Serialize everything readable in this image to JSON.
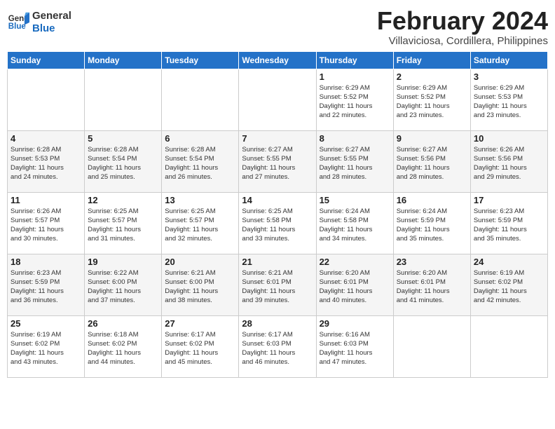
{
  "logo": {
    "line1": "General",
    "line2": "Blue"
  },
  "title": "February 2024",
  "location": "Villaviciosa, Cordillera, Philippines",
  "days_of_week": [
    "Sunday",
    "Monday",
    "Tuesday",
    "Wednesday",
    "Thursday",
    "Friday",
    "Saturday"
  ],
  "weeks": [
    [
      {
        "day": "",
        "info": ""
      },
      {
        "day": "",
        "info": ""
      },
      {
        "day": "",
        "info": ""
      },
      {
        "day": "",
        "info": ""
      },
      {
        "day": "1",
        "info": "Sunrise: 6:29 AM\nSunset: 5:52 PM\nDaylight: 11 hours\nand 22 minutes."
      },
      {
        "day": "2",
        "info": "Sunrise: 6:29 AM\nSunset: 5:52 PM\nDaylight: 11 hours\nand 23 minutes."
      },
      {
        "day": "3",
        "info": "Sunrise: 6:29 AM\nSunset: 5:53 PM\nDaylight: 11 hours\nand 23 minutes."
      }
    ],
    [
      {
        "day": "4",
        "info": "Sunrise: 6:28 AM\nSunset: 5:53 PM\nDaylight: 11 hours\nand 24 minutes."
      },
      {
        "day": "5",
        "info": "Sunrise: 6:28 AM\nSunset: 5:54 PM\nDaylight: 11 hours\nand 25 minutes."
      },
      {
        "day": "6",
        "info": "Sunrise: 6:28 AM\nSunset: 5:54 PM\nDaylight: 11 hours\nand 26 minutes."
      },
      {
        "day": "7",
        "info": "Sunrise: 6:27 AM\nSunset: 5:55 PM\nDaylight: 11 hours\nand 27 minutes."
      },
      {
        "day": "8",
        "info": "Sunrise: 6:27 AM\nSunset: 5:55 PM\nDaylight: 11 hours\nand 28 minutes."
      },
      {
        "day": "9",
        "info": "Sunrise: 6:27 AM\nSunset: 5:56 PM\nDaylight: 11 hours\nand 28 minutes."
      },
      {
        "day": "10",
        "info": "Sunrise: 6:26 AM\nSunset: 5:56 PM\nDaylight: 11 hours\nand 29 minutes."
      }
    ],
    [
      {
        "day": "11",
        "info": "Sunrise: 6:26 AM\nSunset: 5:57 PM\nDaylight: 11 hours\nand 30 minutes."
      },
      {
        "day": "12",
        "info": "Sunrise: 6:25 AM\nSunset: 5:57 PM\nDaylight: 11 hours\nand 31 minutes."
      },
      {
        "day": "13",
        "info": "Sunrise: 6:25 AM\nSunset: 5:57 PM\nDaylight: 11 hours\nand 32 minutes."
      },
      {
        "day": "14",
        "info": "Sunrise: 6:25 AM\nSunset: 5:58 PM\nDaylight: 11 hours\nand 33 minutes."
      },
      {
        "day": "15",
        "info": "Sunrise: 6:24 AM\nSunset: 5:58 PM\nDaylight: 11 hours\nand 34 minutes."
      },
      {
        "day": "16",
        "info": "Sunrise: 6:24 AM\nSunset: 5:59 PM\nDaylight: 11 hours\nand 35 minutes."
      },
      {
        "day": "17",
        "info": "Sunrise: 6:23 AM\nSunset: 5:59 PM\nDaylight: 11 hours\nand 35 minutes."
      }
    ],
    [
      {
        "day": "18",
        "info": "Sunrise: 6:23 AM\nSunset: 5:59 PM\nDaylight: 11 hours\nand 36 minutes."
      },
      {
        "day": "19",
        "info": "Sunrise: 6:22 AM\nSunset: 6:00 PM\nDaylight: 11 hours\nand 37 minutes."
      },
      {
        "day": "20",
        "info": "Sunrise: 6:21 AM\nSunset: 6:00 PM\nDaylight: 11 hours\nand 38 minutes."
      },
      {
        "day": "21",
        "info": "Sunrise: 6:21 AM\nSunset: 6:01 PM\nDaylight: 11 hours\nand 39 minutes."
      },
      {
        "day": "22",
        "info": "Sunrise: 6:20 AM\nSunset: 6:01 PM\nDaylight: 11 hours\nand 40 minutes."
      },
      {
        "day": "23",
        "info": "Sunrise: 6:20 AM\nSunset: 6:01 PM\nDaylight: 11 hours\nand 41 minutes."
      },
      {
        "day": "24",
        "info": "Sunrise: 6:19 AM\nSunset: 6:02 PM\nDaylight: 11 hours\nand 42 minutes."
      }
    ],
    [
      {
        "day": "25",
        "info": "Sunrise: 6:19 AM\nSunset: 6:02 PM\nDaylight: 11 hours\nand 43 minutes."
      },
      {
        "day": "26",
        "info": "Sunrise: 6:18 AM\nSunset: 6:02 PM\nDaylight: 11 hours\nand 44 minutes."
      },
      {
        "day": "27",
        "info": "Sunrise: 6:17 AM\nSunset: 6:02 PM\nDaylight: 11 hours\nand 45 minutes."
      },
      {
        "day": "28",
        "info": "Sunrise: 6:17 AM\nSunset: 6:03 PM\nDaylight: 11 hours\nand 46 minutes."
      },
      {
        "day": "29",
        "info": "Sunrise: 6:16 AM\nSunset: 6:03 PM\nDaylight: 11 hours\nand 47 minutes."
      },
      {
        "day": "",
        "info": ""
      },
      {
        "day": "",
        "info": ""
      }
    ]
  ]
}
